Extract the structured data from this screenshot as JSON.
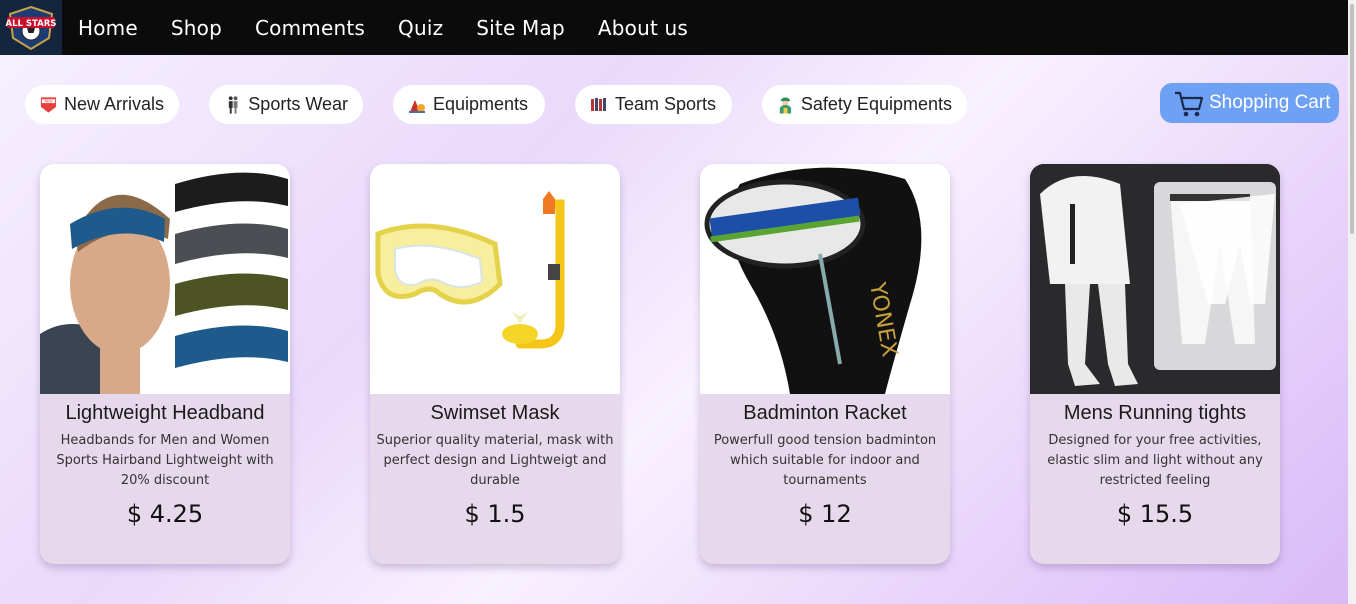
{
  "nav": {
    "logo_text": "ALL STARS",
    "links": [
      "Home",
      "Shop",
      "Comments",
      "Quiz",
      "Site Map",
      "About us"
    ]
  },
  "categories": [
    {
      "label": "New Arrivals",
      "icon": "new-badge-icon"
    },
    {
      "label": "Sports Wear",
      "icon": "sports-wear-icon"
    },
    {
      "label": "Equipments",
      "icon": "equipment-icon"
    },
    {
      "label": "Team Sports",
      "icon": "team-sports-icon"
    },
    {
      "label": "Safety Equipments",
      "icon": "safety-worker-icon"
    }
  ],
  "cart": {
    "label": "Shopping Cart",
    "icon": "shopping-cart-icon"
  },
  "products": [
    {
      "title": "Lightweight Headband",
      "description": "Headbands for Men and Women Sports Hairband Lightweight with 20% discount",
      "price": "$ 4.25"
    },
    {
      "title": "Swimset Mask",
      "description": "Superior quality material, mask with perfect design and Lightweigt and durable",
      "price": "$ 1.5"
    },
    {
      "title": "Badminton Racket",
      "description": "Powerfull good tension badminton which suitable for indoor and tournaments",
      "price": "$ 12"
    },
    {
      "title": "Mens Running tights",
      "description": "Designed for your free activities, elastic slim and light without any restricted feeling",
      "price": "$ 15.5"
    }
  ],
  "colors": {
    "nav_bg": "#0b0b0b",
    "cart_bg": "#6ea0f4",
    "card_bg": "#e6d9ec"
  }
}
